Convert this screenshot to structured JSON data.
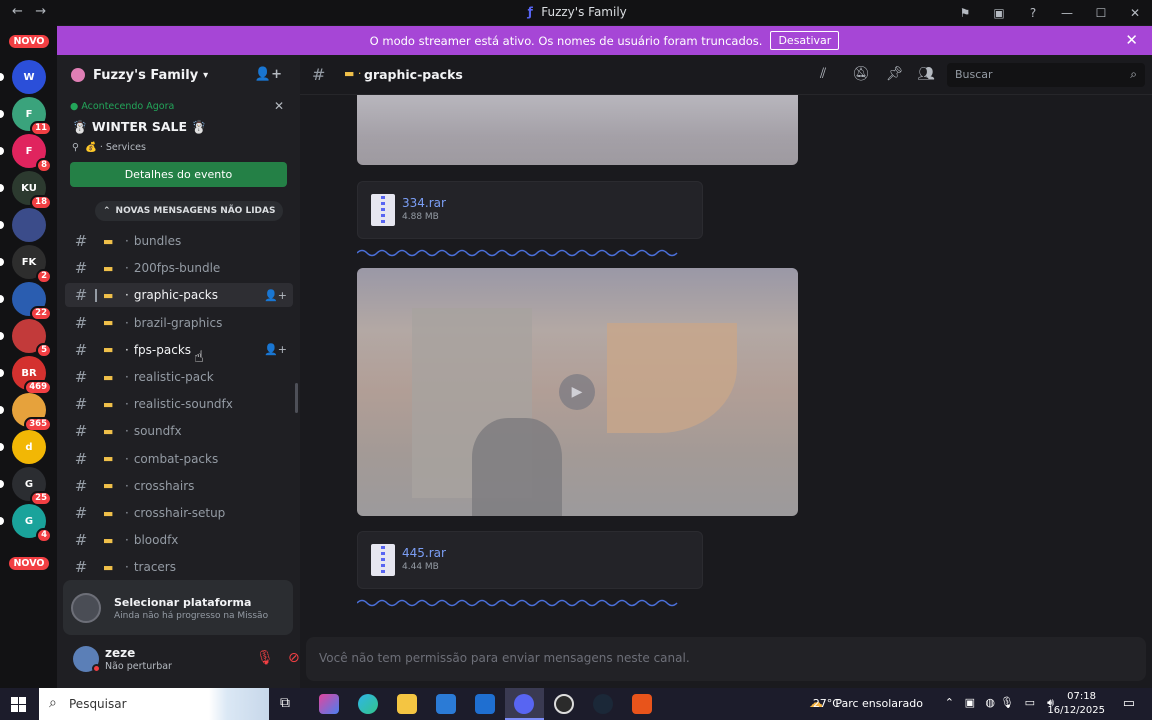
{
  "window": {
    "title": "Fuzzy's Family"
  },
  "banner": {
    "text": "O modo streamer está ativo. Os nomes de usuário foram truncados.",
    "button": "Desativar"
  },
  "guilds": {
    "top_badge": "NOVO",
    "bottom_badge": "NOVO",
    "items": [
      {
        "label": "W",
        "color": "#2b4fd9",
        "badge": ""
      },
      {
        "label": "F",
        "color": "#3aa37c",
        "badge": "11"
      },
      {
        "label": "F",
        "color": "#e0245e",
        "badge": "8"
      },
      {
        "label": "KU",
        "color": "#2c3a2f",
        "badge": "18"
      },
      {
        "label": "",
        "color": "#3b4c8a",
        "badge": ""
      },
      {
        "label": "FK",
        "color": "#2d2d2d",
        "badge": "2"
      },
      {
        "label": "",
        "color": "#2a5db0",
        "badge": "22"
      },
      {
        "label": "",
        "color": "#c23a3a",
        "badge": "5"
      },
      {
        "label": "BR",
        "color": "#d4312f",
        "badge": "469"
      },
      {
        "label": "",
        "color": "#e6a23c",
        "badge": "365"
      },
      {
        "label": "d",
        "color": "#f2b705",
        "badge": ""
      },
      {
        "label": "G",
        "color": "#2b2d31",
        "badge": "25"
      },
      {
        "label": "G",
        "color": "#1aa39b",
        "badge": "4"
      }
    ]
  },
  "server": {
    "name": "Fuzzy's Family"
  },
  "event": {
    "status": "Acontecendo Agora",
    "name": "☃️ WINTER SALE ☃️",
    "location": "💰 · Services",
    "button": "Detalhes do evento"
  },
  "new_messages_pill": "NOVAS MENSAGENS NÃO LIDAS",
  "channels": [
    {
      "name": "bundles",
      "state": "normal"
    },
    {
      "name": "200fps-bundle",
      "state": "normal"
    },
    {
      "name": "graphic-packs",
      "state": "selected"
    },
    {
      "name": "brazil-graphics",
      "state": "normal"
    },
    {
      "name": "fps-packs",
      "state": "unread"
    },
    {
      "name": "realistic-pack",
      "state": "normal"
    },
    {
      "name": "realistic-soundfx",
      "state": "normal"
    },
    {
      "name": "soundfx",
      "state": "normal"
    },
    {
      "name": "combat-packs",
      "state": "normal"
    },
    {
      "name": "crosshairs",
      "state": "normal"
    },
    {
      "name": "crosshair-setup",
      "state": "normal"
    },
    {
      "name": "bloodfx",
      "state": "normal"
    },
    {
      "name": "tracers",
      "state": "normal"
    }
  ],
  "quest": {
    "title": "Selecionar plataforma",
    "subtitle": "Ainda não há progresso na Missão"
  },
  "user": {
    "name": "zeze",
    "status": "Não perturbar"
  },
  "channel_header": {
    "name": "graphic-packs",
    "search_placeholder": "Buscar"
  },
  "messages": {
    "files": [
      {
        "name": "334.rar",
        "size": "4.88 MB"
      },
      {
        "name": "445.rar",
        "size": "4.44 MB"
      }
    ]
  },
  "composer": {
    "placeholder": "Você não tem permissão para enviar mensagens neste canal."
  },
  "taskbar": {
    "search": "Pesquisar",
    "weather_temp": "27°C",
    "weather_desc": "Parc ensolarado",
    "time": "07:18",
    "date": "16/12/2025"
  }
}
